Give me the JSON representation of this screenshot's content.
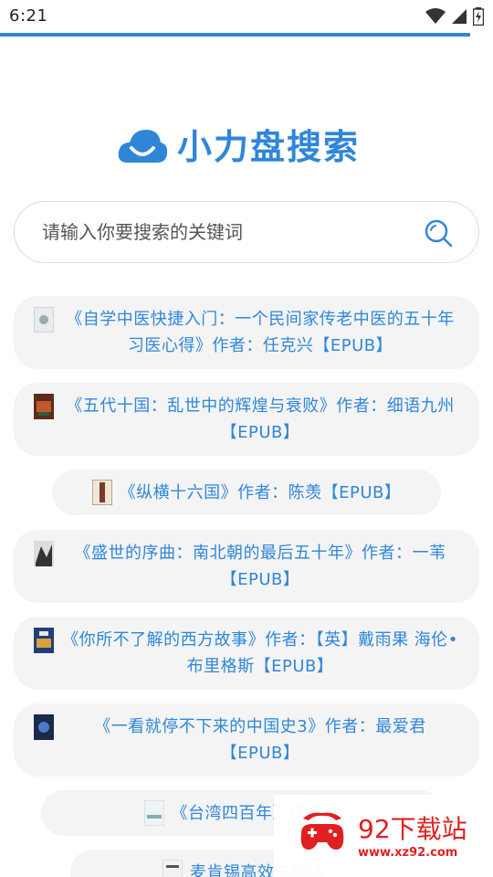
{
  "status_bar": {
    "time": "6:21",
    "icons": [
      "wifi-icon",
      "signal-icon",
      "battery-icon"
    ]
  },
  "app": {
    "title": "小力盘搜索",
    "accent_color": "#2f86d9"
  },
  "search": {
    "placeholder": "请输入你要搜索的关键词",
    "value": ""
  },
  "results": [
    {
      "text": "《自学中医快捷入门：一个民间家传老中医的五十年习医心得》作者：任克兴【EPUB】"
    },
    {
      "text": "《五代十国：乱世中的辉煌与衰败》作者：细语九州【EPUB】"
    },
    {
      "text": "《纵横十六国》作者：陈羡【EPUB】"
    },
    {
      "text": "《盛世的序曲：南北朝的最后五十年》作者：一苇【EPUB】"
    },
    {
      "text": "《你所不了解的西方故事》作者：【英】戴雨果 海伦•布里格斯【EPUB】"
    },
    {
      "text": "《一看就停不下来的中国史3》作者：最爱君【EPUB】"
    },
    {
      "text": "《台湾四百年》作者："
    },
    {
      "text": "麦肯锡高效工作法"
    }
  ],
  "watermark": {
    "title": "92下载站",
    "url": "www.xz92.com"
  }
}
